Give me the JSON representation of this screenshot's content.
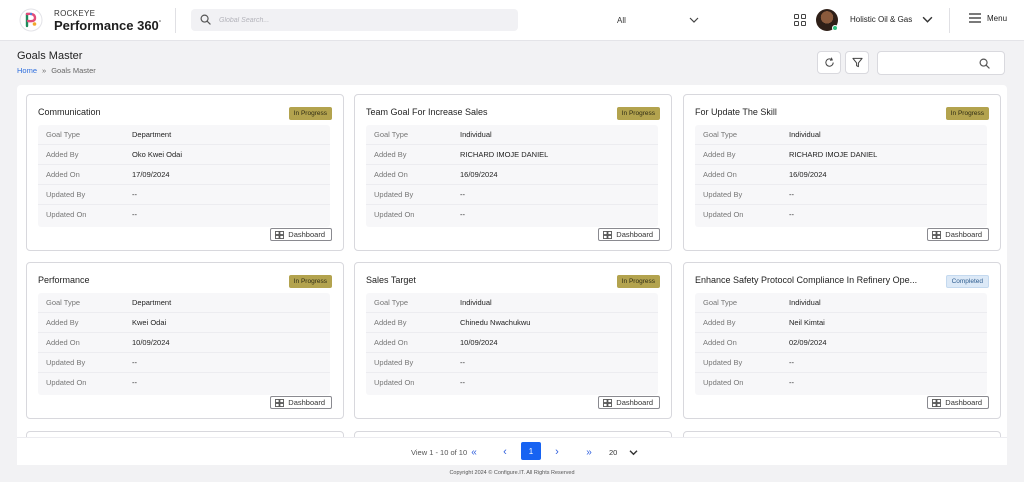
{
  "brand": {
    "small": "ROCKEYE",
    "name": "Performance 360",
    "mark": "°"
  },
  "header": {
    "search_placeholder": "Global Search...",
    "scope_value": "All",
    "org_name": "Holistic Oil & Gas",
    "menu_label": "Menu"
  },
  "page": {
    "title": "Goals Master",
    "breadcrumb": {
      "home": "Home",
      "separator": "»",
      "current": "Goals Master"
    }
  },
  "labels": {
    "goal_type": "Goal Type",
    "added_by": "Added By",
    "added_on": "Added On",
    "updated_by": "Updated By",
    "updated_on": "Updated On",
    "dashboard": "Dashboard"
  },
  "goals": [
    {
      "title": "Communication",
      "status": "In Progress",
      "goal_type": "Department",
      "added_by": "Oko Kwei Odai",
      "added_on": "17/09/2024",
      "updated_by": "--",
      "updated_on": "--"
    },
    {
      "title": "Team Goal For Increase Sales",
      "status": "In Progress",
      "goal_type": "Individual",
      "added_by": "RICHARD IMOJE DANIEL",
      "added_on": "16/09/2024",
      "updated_by": "--",
      "updated_on": "--"
    },
    {
      "title": "For Update The Skill",
      "status": "In Progress",
      "goal_type": "Individual",
      "added_by": "RICHARD IMOJE DANIEL",
      "added_on": "16/09/2024",
      "updated_by": "--",
      "updated_on": "--"
    },
    {
      "title": "Performance",
      "status": "In Progress",
      "goal_type": "Department",
      "added_by": "Kwei Odai",
      "added_on": "10/09/2024",
      "updated_by": "--",
      "updated_on": "--"
    },
    {
      "title": "Sales Target",
      "status": "In Progress",
      "goal_type": "Individual",
      "added_by": "Chinedu Nwachukwu",
      "added_on": "10/09/2024",
      "updated_by": "--",
      "updated_on": "--"
    },
    {
      "title": "Enhance Safety Protocol Compliance In Refinery Ope...",
      "status": "Completed",
      "goal_type": "Individual",
      "added_by": "Neil Kimtai",
      "added_on": "02/09/2024",
      "updated_by": "--",
      "updated_on": "--"
    }
  ],
  "pagination": {
    "info": "View 1 - 10 of 10",
    "first": "«",
    "prev": "‹",
    "current_page": "1",
    "next": "›",
    "last": "»",
    "per_page": "20"
  },
  "footer": "Copyright 2024 © Configure.IT. All Rights Reserved",
  "colors": {
    "accent": "#1763f2",
    "in_progress": "#b3a34e",
    "completed": "#dce9f7"
  },
  "icons": [
    "logo-icon",
    "search-icon",
    "chevron-down-icon",
    "apps-grid-icon",
    "hamburger-menu-icon",
    "refresh-icon",
    "filter-icon",
    "dashboard-icon"
  ]
}
